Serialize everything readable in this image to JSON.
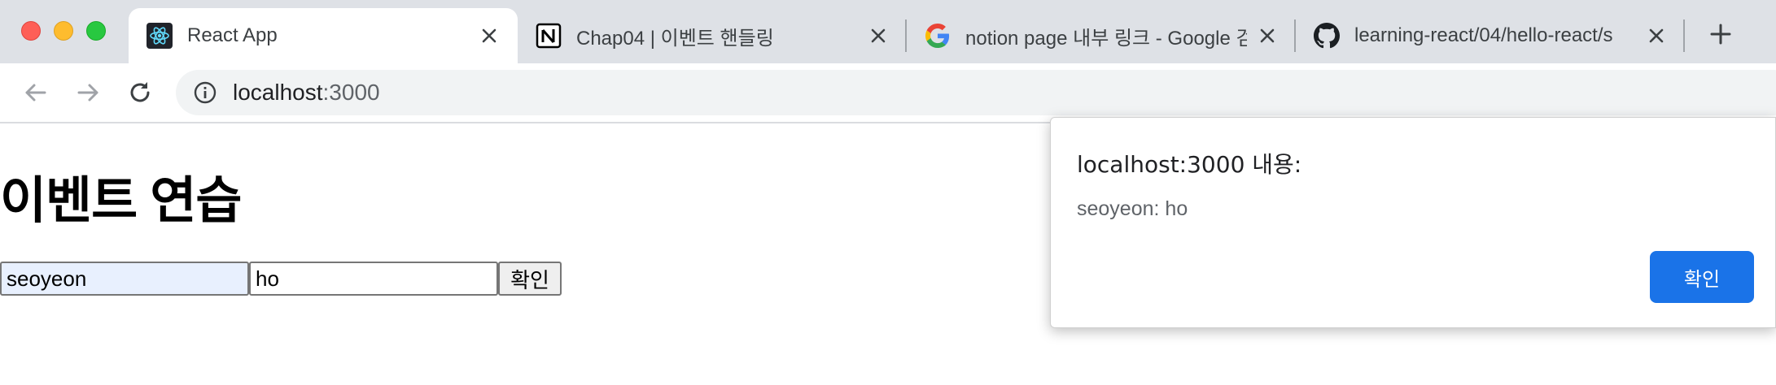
{
  "tabs": [
    {
      "title": "React App",
      "icon": "react-icon",
      "active": true
    },
    {
      "title": "Chap04 | 이벤트 핸들링",
      "icon": "notion-icon",
      "active": false
    },
    {
      "title": "notion page 내부 링크 - Google 검",
      "icon": "google-icon",
      "active": false
    },
    {
      "title": "learning-react/04/hello-react/s",
      "icon": "github-icon",
      "active": false
    }
  ],
  "toolbar": {
    "url_host": "localhost",
    "url_port": ":3000"
  },
  "page": {
    "heading": "이벤트 연습",
    "username_value": "seoyeon",
    "message_value": "ho",
    "submit_label": "확인"
  },
  "dialog": {
    "title": "localhost:3000 내용:",
    "message": "seoyeon: ho",
    "ok_label": "확인"
  },
  "colors": {
    "accent": "#1a73e8",
    "tabstrip": "#dee1e6",
    "autofill": "#e8f0fe"
  }
}
